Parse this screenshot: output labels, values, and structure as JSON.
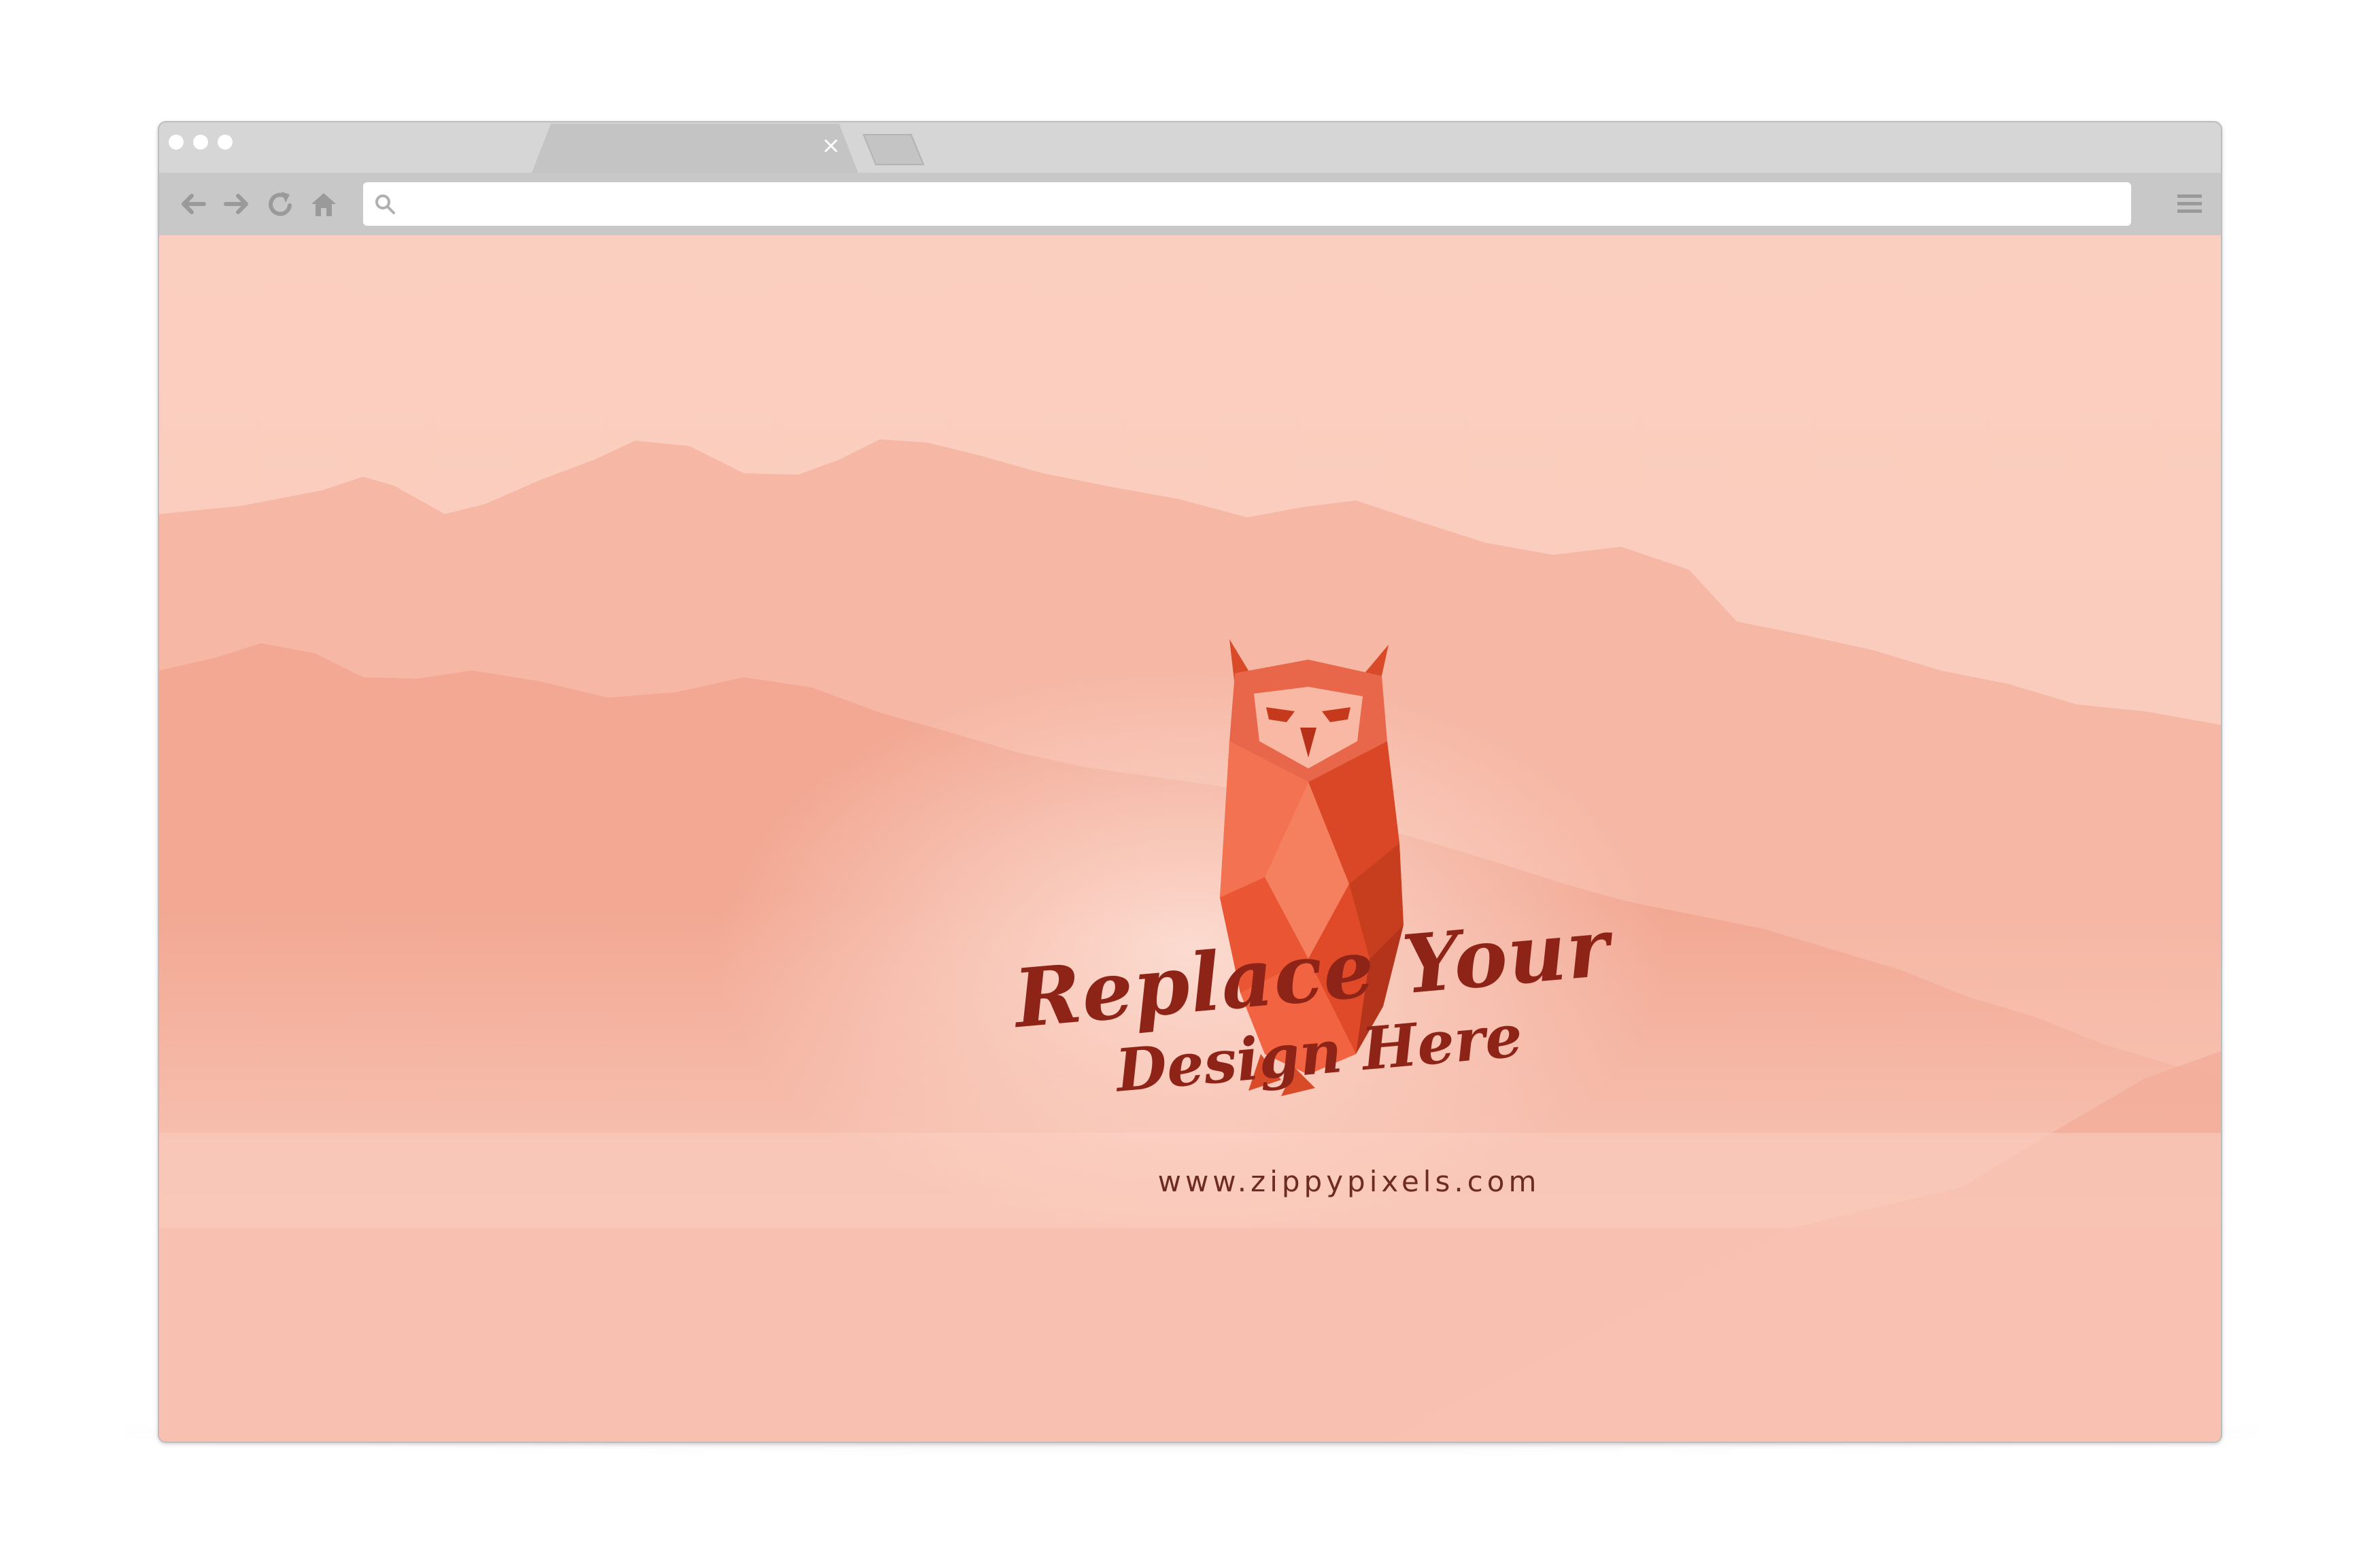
{
  "browser": {
    "window_buttons": [
      "close",
      "minimize",
      "maximize"
    ],
    "tab": {
      "title": "",
      "close_glyph": "×"
    },
    "toolbar": {
      "back_icon": "arrow-left-icon",
      "forward_icon": "arrow-right-icon",
      "reload_icon": "reload-icon",
      "home_icon": "home-icon",
      "menu_icon": "hamburger-menu-icon"
    },
    "address_bar": {
      "value": "",
      "placeholder": "",
      "icon": "search-icon"
    }
  },
  "page": {
    "headline_line1": "Replace Your",
    "headline_line2": "Design Here",
    "url_text": "www.zippypixels.com",
    "logo_icon": "owl-icon"
  },
  "colors": {
    "chrome_light": "#d6d6d6",
    "chrome_dark": "#c8c8c8",
    "background_peach": "#f8c9bb",
    "mountain_coral": "#f0a28e",
    "owl_orange": "#ee5a35",
    "headline_red": "#8e2317",
    "url_brown": "#6e2b22"
  }
}
